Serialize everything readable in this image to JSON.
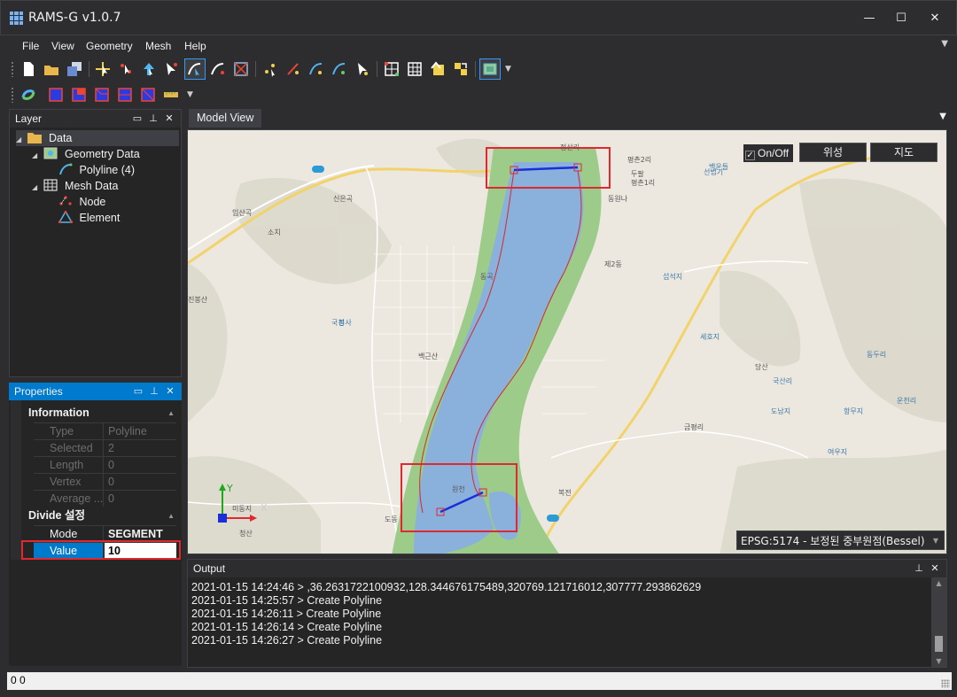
{
  "window": {
    "title": "RAMS-G v1.0.7",
    "minimize_label": "—",
    "maximize_label": "☐",
    "close_label": "✕"
  },
  "menu": [
    "File",
    "View",
    "Geometry",
    "Mesh",
    "Help"
  ],
  "layer_panel": {
    "title": "Layer",
    "tree": {
      "root": "Data",
      "geometry": "Geometry Data",
      "polyline": "Polyline (4)",
      "mesh": "Mesh Data",
      "node": "Node",
      "element": "Element"
    }
  },
  "properties_panel": {
    "title": "Properties",
    "info_category": "Information",
    "info_rows": [
      {
        "name": "Type",
        "value": "Polyline"
      },
      {
        "name": "Selected",
        "value": "2"
      },
      {
        "name": "Length",
        "value": "0"
      },
      {
        "name": "Vertex",
        "value": "0"
      },
      {
        "name": "Average ...",
        "value": "0"
      }
    ],
    "divide_category": "Divide 설정",
    "divide_rows": [
      {
        "name": "Mode",
        "value": "SEGMENT"
      },
      {
        "name": "Value",
        "value": "10"
      }
    ]
  },
  "model_view": {
    "tab_label": "Model View",
    "onoff_label": "On/Off",
    "satellite_button": "위성",
    "map_button": "지도",
    "crs_value": "EPSG:5174 - 보정된 중부원점(Bessel)",
    "axis_y": "Y",
    "axis_x": "X",
    "map_labels": [
      "정산리",
      "평촌2리",
      "선법기",
      "평촌1리",
      "도동",
      "원천",
      "국산리",
      "항무지",
      "섭석지",
      "세호지",
      "동원나",
      "제2동",
      "국전",
      "여우지",
      "임산곡",
      "신은곡",
      "동두리",
      "복전",
      "도남지",
      "진봉산",
      "백운들",
      "백근산",
      "동곡",
      "봉사",
      "당산",
      "두팔",
      "청산",
      "미동지",
      "소치",
      "금평리",
      "운천리"
    ]
  },
  "output_panel": {
    "title": "Output",
    "lines": [
      "2021-01-15 14:24:46 > ,36.2631722100932,128.344676175489,320769.121716012,307777.293862629",
      "2021-01-15 14:25:57 > Create Polyline",
      "2021-01-15 14:26:11 > Create Polyline",
      "2021-01-15 14:26:14 > Create Polyline",
      "2021-01-15 14:26:27 > Create Polyline"
    ]
  },
  "status": {
    "text": "0 0"
  },
  "colors": {
    "accent": "#007acc",
    "river": "#8ab0dc",
    "floodplain": "#9ccb8a",
    "selection_box": "#e0282e",
    "polyline": "#1a2fd8"
  }
}
